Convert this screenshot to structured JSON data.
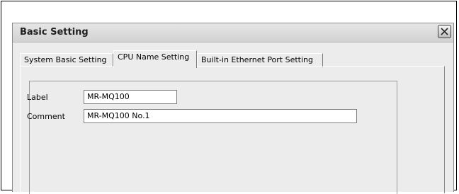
{
  "window": {
    "title": "Basic Setting",
    "close_label": "×"
  },
  "tabs": [
    {
      "label": "System Basic Setting",
      "selected": false
    },
    {
      "label": "CPU Name Setting",
      "selected": true
    },
    {
      "label": "Built-in Ethernet Port Setting",
      "selected": false
    }
  ],
  "form": {
    "label": {
      "caption": "Label",
      "value": "MR-MQ100"
    },
    "comment": {
      "caption": "Comment",
      "value": "MR-MQ100 No.1"
    }
  }
}
